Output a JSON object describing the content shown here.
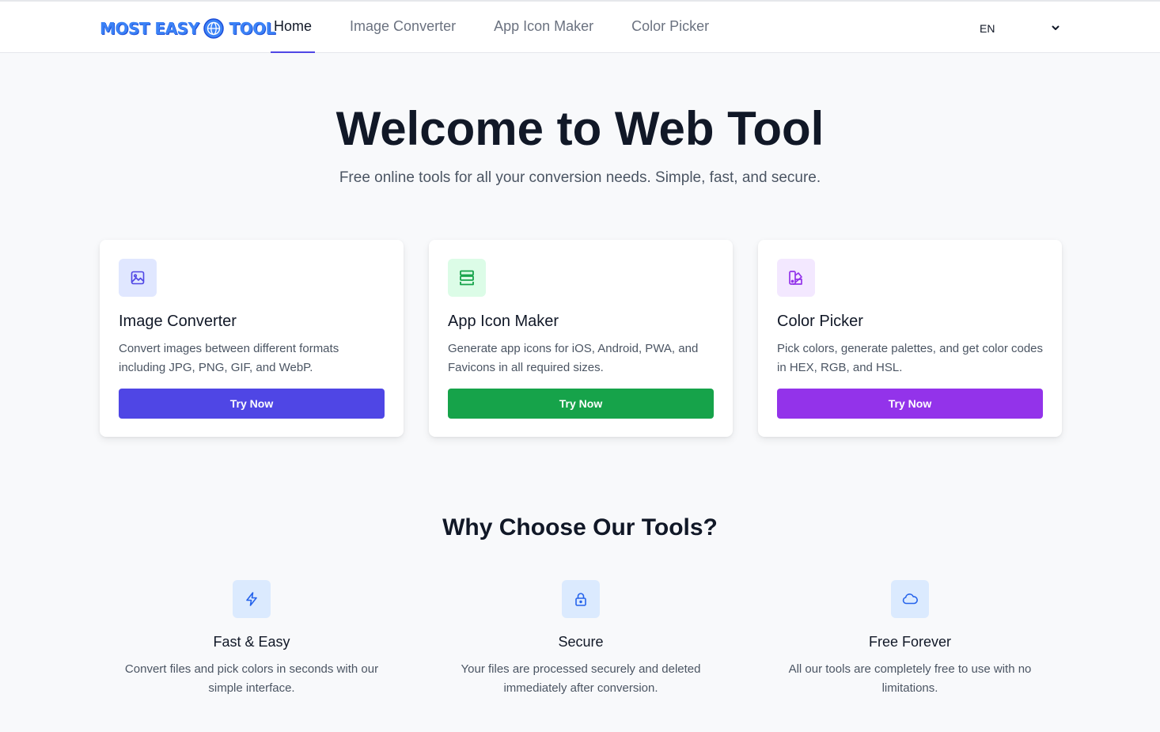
{
  "header": {
    "logo": {
      "left": "MOST EASY",
      "right": "TOOL"
    },
    "nav": [
      {
        "label": "Home",
        "active": true
      },
      {
        "label": "Image Converter",
        "active": false
      },
      {
        "label": "App Icon Maker",
        "active": false
      },
      {
        "label": "Color Picker",
        "active": false
      }
    ],
    "language": {
      "selected": "EN"
    }
  },
  "hero": {
    "title": "Welcome to Web Tool",
    "subtitle": "Free online tools for all your conversion needs. Simple, fast, and secure."
  },
  "cards": [
    {
      "icon": "image-icon",
      "title": "Image Converter",
      "description": "Convert images between different formats including JPG, PNG, GIF, and WebP.",
      "button": "Try Now",
      "accent": "#4f46e5",
      "icon_bg": "#e0e7ff"
    },
    {
      "icon": "app-stack-icon",
      "title": "App Icon Maker",
      "description": "Generate app icons for iOS, Android, PWA, and Favicons in all required sizes.",
      "button": "Try Now",
      "accent": "#16a34a",
      "icon_bg": "#dcfce7"
    },
    {
      "icon": "palette-icon",
      "title": "Color Picker",
      "description": "Pick colors, generate palettes, and get color codes in HEX, RGB, and HSL.",
      "button": "Try Now",
      "accent": "#9333ea",
      "icon_bg": "#f3e8ff"
    }
  ],
  "why": {
    "title": "Why Choose Our Tools?",
    "features": [
      {
        "icon": "lightning-icon",
        "title": "Fast & Easy",
        "description": "Convert files and pick colors in seconds with our simple interface."
      },
      {
        "icon": "lock-icon",
        "title": "Secure",
        "description": "Your files are processed securely and deleted immediately after conversion."
      },
      {
        "icon": "cloud-icon",
        "title": "Free Forever",
        "description": "All our tools are completely free to use with no limitations."
      }
    ]
  }
}
